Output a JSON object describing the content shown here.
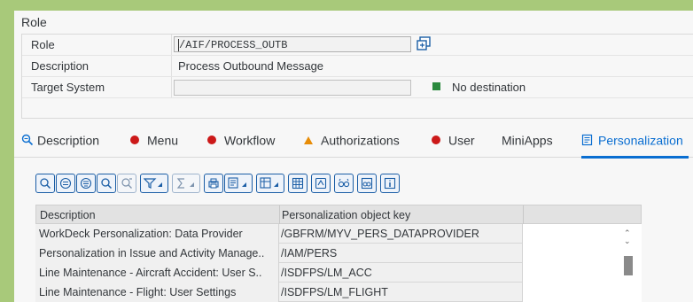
{
  "section_title": "Role",
  "fields": {
    "role_label": "Role",
    "role_value": "/AIF/PROCESS_OUTB",
    "description_label": "Description",
    "description_value": "Process Outbound Message",
    "target_label": "Target System",
    "target_status": "No destination",
    "target_status_color": "#2b8a3e"
  },
  "tabs": [
    {
      "label": "Description",
      "icon": "zoom-icon"
    },
    {
      "label": "Menu",
      "icon": "red-dot-icon"
    },
    {
      "label": "Workflow",
      "icon": "red-dot-icon"
    },
    {
      "label": "Authorizations",
      "icon": "warning-triangle-icon"
    },
    {
      "label": "User",
      "icon": "red-dot-icon"
    },
    {
      "label": "MiniApps",
      "icon": ""
    },
    {
      "label": "Personalization",
      "icon": "personalization-icon",
      "active": true
    }
  ],
  "toolbar_icons": [
    "details-icon",
    "align-icon",
    "filter-lines-icon",
    "find-icon",
    "find-next-icon",
    "filter-icon",
    "sum-icon",
    "print-icon",
    "export-icon",
    "layout-icon",
    "grid-icon",
    "variant-icon",
    "glasses-icon",
    "binoculars-icon",
    "info-icon"
  ],
  "table": {
    "headers": [
      "Description",
      "Personalization object key"
    ],
    "rows": [
      [
        "WorkDeck Personalization: Data Provider",
        "/GBFRM/MYV_PERS_DATAPROVIDER"
      ],
      [
        "Personalization in Issue and Activity Manage..",
        "/IAM/PERS"
      ],
      [
        "Line Maintenance - Aircraft Accident: User S..",
        "/ISDFPS/LM_ACC"
      ],
      [
        "Line Maintenance - Flight: User Settings",
        "/ISDFPS/LM_FLIGHT"
      ]
    ]
  },
  "colors": {
    "accent": "#0a6ed1",
    "error": "#cc1919",
    "warning": "#e78c07",
    "background": "#a8c97a"
  }
}
